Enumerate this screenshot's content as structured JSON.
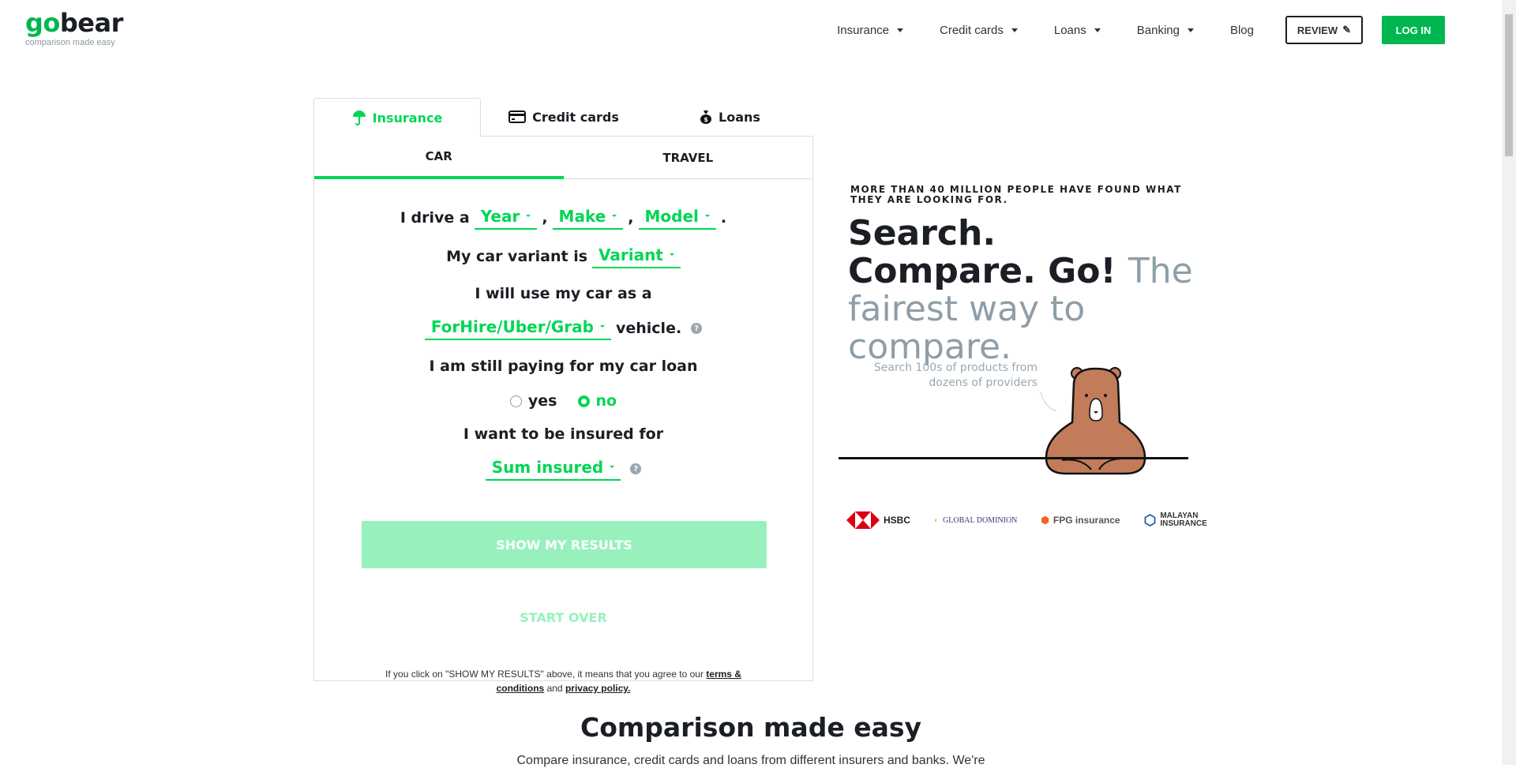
{
  "logo": {
    "word_go": "go",
    "word_bear": "bear",
    "tagline": "comparison made easy"
  },
  "nav": {
    "items": [
      "Insurance",
      "Credit cards",
      "Loans",
      "Banking"
    ],
    "blog": "Blog",
    "review": "REVIEW",
    "login": "LOG IN"
  },
  "tabs": [
    {
      "label": "Insurance",
      "icon": "umbrella-icon"
    },
    {
      "label": "Credit cards",
      "icon": "credit-card-icon"
    },
    {
      "label": "Loans",
      "icon": "money-bag-icon"
    }
  ],
  "subtabs": [
    "CAR",
    "TRAVEL"
  ],
  "form": {
    "drive_prefix": "I drive a",
    "year": "Year",
    "make": "Make",
    "model": "Model",
    "comma": ",",
    "period": ".",
    "variant_prefix": "My car variant is",
    "variant": "Variant",
    "use_text": "I will use my car as a",
    "use_value": "ForHire/Uber/Grab",
    "use_suffix": "vehicle.",
    "loan_text": "I am still paying for my car loan",
    "yes": "yes",
    "no": "no",
    "loan_selected": "no",
    "insured_text": "I want to be insured for",
    "sum_insured": "Sum insured",
    "submit": "SHOW MY RESULTS",
    "start_over": "START OVER",
    "disclaimer": "If you click on \"SHOW MY RESULTS\" above, it means that you agree to our ",
    "terms": "terms & conditions",
    "and": " and ",
    "privacy": "privacy policy."
  },
  "hero": {
    "small": "MORE THAN 40 MILLION PEOPLE HAVE FOUND WHAT THEY ARE LOOKING FOR.",
    "big_dark": "Search. Compare. Go!",
    "big_grey": "The fairest way to compare.",
    "note": "Search 100s of products from dozens of providers"
  },
  "partners": [
    "HSBC",
    "GLOBAL DOMINION",
    "FPG insurance",
    "MALAYAN INSURANCE"
  ],
  "section": {
    "title": "Comparison made easy",
    "subtitle": "Compare insurance, credit cards and loans from different insurers and banks. We're"
  },
  "colors": {
    "accent": "#00d656",
    "login": "#00b74f",
    "disabled_button": "#98f1bd"
  }
}
